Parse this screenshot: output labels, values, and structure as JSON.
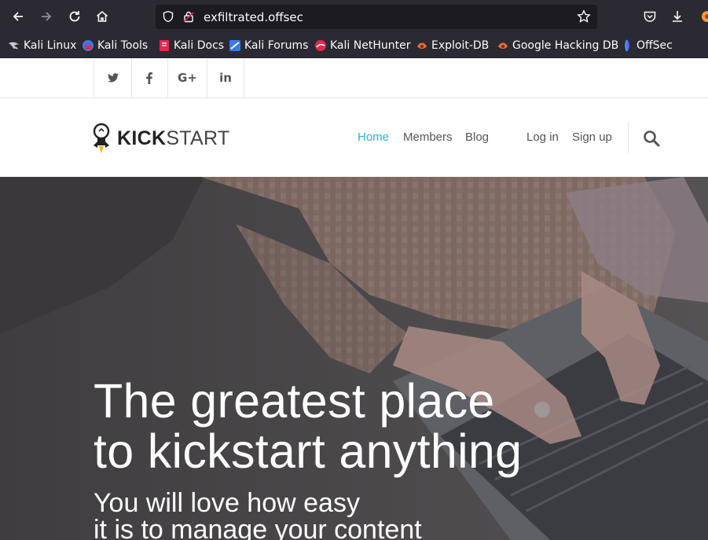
{
  "browser": {
    "url": "exfiltrated.offsec",
    "bookmarks": [
      {
        "label": "Kali Linux",
        "icon": "kali-dragon-icon"
      },
      {
        "label": "Kali Tools",
        "icon": "kali-tools-icon"
      },
      {
        "label": "Kali Docs",
        "icon": "kali-docs-icon"
      },
      {
        "label": "Kali Forums",
        "icon": "kali-forums-icon"
      },
      {
        "label": "Kali NetHunter",
        "icon": "nethunter-icon"
      },
      {
        "label": "Exploit-DB",
        "icon": "exploit-db-icon"
      },
      {
        "label": "Google Hacking DB",
        "icon": "ghdb-icon"
      },
      {
        "label": "OffSec",
        "icon": "offsec-icon"
      }
    ]
  },
  "social": {
    "twitter": "twitter-icon",
    "facebook": "facebook-icon",
    "googleplus": "G+",
    "linkedin": "in"
  },
  "header": {
    "logo_bold": "KICK",
    "logo_light": "START",
    "nav": {
      "home": "Home",
      "members": "Members",
      "blog": "Blog",
      "login": "Log in",
      "signup": "Sign up"
    }
  },
  "hero": {
    "title_line1": "The greatest place",
    "title_line2": "to kickstart anything",
    "subtitle_line1": "You will love how easy",
    "subtitle_line2": "it is to manage your content"
  },
  "colors": {
    "browser_bg": "#2b2a33",
    "urlbar_bg": "#1c1b22",
    "accent": "#24b6d4",
    "hero_overlay": "#4c4a4c"
  }
}
